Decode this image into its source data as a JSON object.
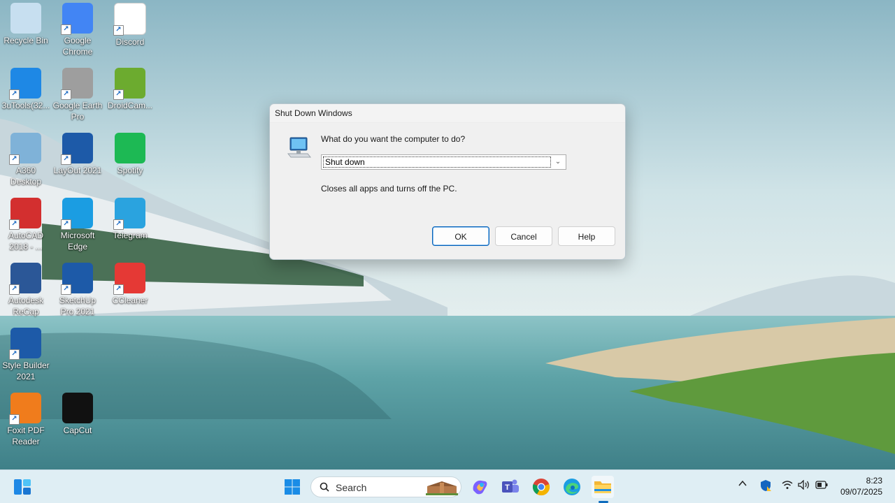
{
  "desktop_icons": [
    {
      "label": "Recycle Bin",
      "icon": "recycle-bin-icon",
      "color": "#c7dff0",
      "shortcut": false
    },
    {
      "label": "Google Chrome",
      "icon": "chrome-icon",
      "color": "#4285f4",
      "shortcut": true
    },
    {
      "label": "Discord",
      "icon": "document-icon",
      "color": "#ffffff",
      "shortcut": true
    },
    {
      "label": "3uTools(32...",
      "icon": "3utools-icon",
      "color": "#1e88e5",
      "shortcut": true
    },
    {
      "label": "Google Earth Pro",
      "icon": "google-earth-pro-icon",
      "color": "#9e9e9e",
      "shortcut": true
    },
    {
      "label": "DroidCam...",
      "icon": "droidcam-icon",
      "color": "#6cab2f",
      "shortcut": true
    },
    {
      "label": "A360 Desktop",
      "icon": "a360-icon",
      "color": "#7fb2d8",
      "shortcut": true
    },
    {
      "label": "LayOut 2021",
      "icon": "layout-icon",
      "color": "#1d5aa8",
      "shortcut": true
    },
    {
      "label": "Spotify",
      "icon": "spotify-icon",
      "color": "#1db954",
      "shortcut": false
    },
    {
      "label": "AutoCAD 2018 - ...",
      "icon": "autocad-icon",
      "color": "#d32f2f",
      "shortcut": true
    },
    {
      "label": "Microsoft Edge",
      "icon": "edge-icon",
      "color": "#1b9de2",
      "shortcut": true
    },
    {
      "label": "Telegram",
      "icon": "telegram-icon",
      "color": "#2aa3df",
      "shortcut": true
    },
    {
      "label": "Autodesk ReCap",
      "icon": "recap-icon",
      "color": "#2b5797",
      "shortcut": true
    },
    {
      "label": "SketchUp Pro 2021",
      "icon": "sketchup-icon",
      "color": "#1d5aa8",
      "shortcut": true
    },
    {
      "label": "CCleaner",
      "icon": "ccleaner-icon",
      "color": "#e53935",
      "shortcut": true
    },
    {
      "label": "Style Builder 2021",
      "icon": "style-builder-icon",
      "color": "#1d5aa8",
      "shortcut": true
    },
    {
      "label": "Foxit PDF Reader",
      "icon": "foxit-pdf-icon",
      "color": "#f07c1c",
      "shortcut": true
    },
    {
      "label": "CapCut",
      "icon": "capcut-icon",
      "color": "#111111",
      "shortcut": false
    }
  ],
  "dialog": {
    "title": "Shut Down Windows",
    "question": "What do you want the computer to do?",
    "selected_option": "Shut down",
    "description": "Closes all apps and turns off the PC.",
    "ok_label": "OK",
    "cancel_label": "Cancel",
    "help_label": "Help"
  },
  "taskbar": {
    "search_placeholder": "Search",
    "pinned_icons": [
      "widgets-icon",
      "windows-start-icon",
      "copilot-icon",
      "teams-icon",
      "chrome-icon",
      "edge-icon",
      "file-explorer-icon"
    ],
    "tray_icons": [
      "chevron-up-icon",
      "security-shield-icon",
      "wifi-icon",
      "volume-icon",
      "battery-icon"
    ],
    "time": "8:23",
    "date": "09/07/2025",
    "accent_color": "#0f6cbd"
  }
}
